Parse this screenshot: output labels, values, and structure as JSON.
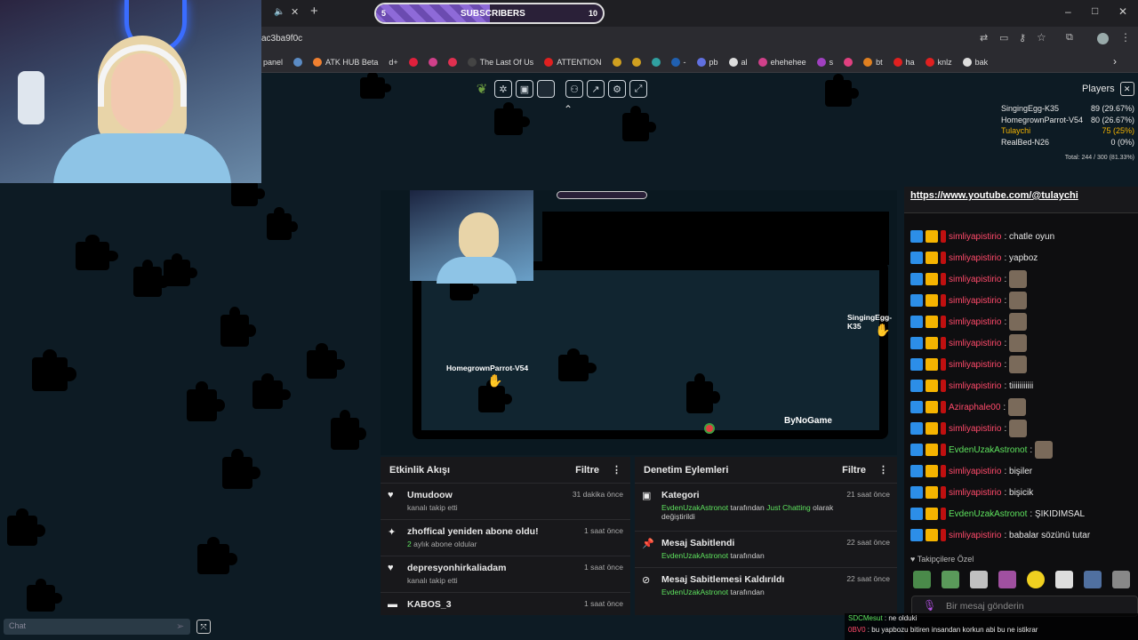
{
  "browser": {
    "url": "ac3ba9f0c",
    "new_tab": "+",
    "bookmarks": [
      "panel",
      "",
      "ATK HUB Beta",
      "d+",
      "",
      "",
      "",
      "The Last Of Us",
      "ATTENTION",
      "",
      "",
      "",
      "-",
      "pb",
      "al",
      "ehehehee",
      "s",
      "bt",
      "ha",
      "knlz",
      "bak"
    ],
    "window_controls": {
      "minimize": "–",
      "maximize": "□",
      "close": "✕"
    },
    "tab_more": "›"
  },
  "subscribers": {
    "label": "SUBSCRIBERS",
    "current": "5",
    "goal": "10",
    "progress": 0.5
  },
  "toolbar": {
    "collapse": "⌃"
  },
  "players": {
    "title": "Players",
    "list": [
      {
        "name": "SingingEgg-K35",
        "score": "89 (29.67%)",
        "color": "#e8e8e8"
      },
      {
        "name": "HomegrownParrot-V54",
        "score": "80 (26.67%)",
        "color": "#e8e8e8"
      },
      {
        "name": "Tulaychi",
        "score": "75 (25%)",
        "color": "#f5b400"
      },
      {
        "name": "RealBed-N26",
        "score": "0 (0%)",
        "color": "#e8e8e8"
      }
    ],
    "total": "Total: 244 / 300 (81.33%)"
  },
  "stream": {
    "cursor1": "SingingEgg-K35",
    "cursor2": "HomegrownParrot-V54",
    "brand": "ByNoGame"
  },
  "activity": {
    "title": "Etkinlik Akışı",
    "filter": "Filtre",
    "items": [
      {
        "icon": "heart-icon",
        "title": "Umudoow",
        "sub": "kanalı takip etti",
        "time": "31 dakika önce"
      },
      {
        "icon": "star-icon",
        "title": "zhoffical yeniden abone oldu!",
        "sub_count": "2",
        "sub": " aylık abone oldular",
        "time": "1 saat önce"
      },
      {
        "icon": "heart-icon",
        "title": "depresyonhirkaliadam",
        "sub": "kanalı takip etti",
        "time": "1 saat önce"
      },
      {
        "icon": "gift-icon",
        "title": "KABOS_3",
        "sub": "",
        "time": "1 saat önce"
      }
    ]
  },
  "moderation": {
    "title": "Denetim Eylemleri",
    "filter": "Filtre",
    "items": [
      {
        "title": "Kategori",
        "user": "EvdenUzakAstronot",
        "mid": " tarafından ",
        "cat": "Just Chatting",
        "tail": " olarak",
        "line2": "değiştirildi",
        "time": "21 saat önce"
      },
      {
        "title": "Mesaj Sabitlendi",
        "user": "EvdenUzakAstronot",
        "mid": " tarafından",
        "time": "22 saat önce"
      },
      {
        "title": "Mesaj Sabitlemesi Kaldırıldı",
        "user": "EvdenUzakAstronot",
        "mid": " tarafından",
        "time": "22 saat önce"
      }
    ]
  },
  "chat": {
    "link": "https://www.youtube.com/@tulaychi",
    "lines": [
      {
        "user": "simliyapistirio",
        "msg": ": chatle oyun"
      },
      {
        "user": "simliyapistirio",
        "msg": ": yapboz"
      },
      {
        "user": "simliyapistirio",
        "msg": ":",
        "emote": true
      },
      {
        "user": "simliyapistirio",
        "msg": ":",
        "emote": true
      },
      {
        "user": "simliyapistirio",
        "msg": ":",
        "emote": true
      },
      {
        "user": "simliyapistirio",
        "msg": ":",
        "emote": true
      },
      {
        "user": "simliyapistirio",
        "msg": ":",
        "emote": true
      },
      {
        "user": "simliyapistirio",
        "msg": ": tiiiiiiiiiii"
      },
      {
        "user": "Aziraphale00",
        "msg": ":",
        "emote": true,
        "color": "#ff4a6a"
      },
      {
        "user": "simliyapistirio",
        "msg": ":",
        "emote": true
      },
      {
        "user": "EvdenUzakAstronot",
        "msg": ":",
        "emote": true,
        "color": "#5ee35e"
      },
      {
        "user": "simliyapistirio",
        "msg": ": bişiler"
      },
      {
        "user": "simliyapistirio",
        "msg": ": bişicik"
      },
      {
        "user": "EvdenUzakAstronot",
        "msg": ": ŞIKIDIMSAL",
        "color": "#5ee35e"
      },
      {
        "user": "simliyapistirio",
        "msg": ": babalar sözünü tutar"
      }
    ],
    "follower_emotes": "Takipçilere Özel",
    "input_placeholder": "Bir mesaj gönderin",
    "overlay": [
      {
        "user": "SDCMesut",
        "msg": " : ne olduki",
        "color": "#5ee35e"
      },
      {
        "user": "0BV0",
        "msg": " : bu yapbozu bitiren insandan korkun abi bu ne istikrar",
        "color": "#ff4a6a"
      }
    ]
  },
  "left_chat": {
    "placeholder": "Chat"
  }
}
